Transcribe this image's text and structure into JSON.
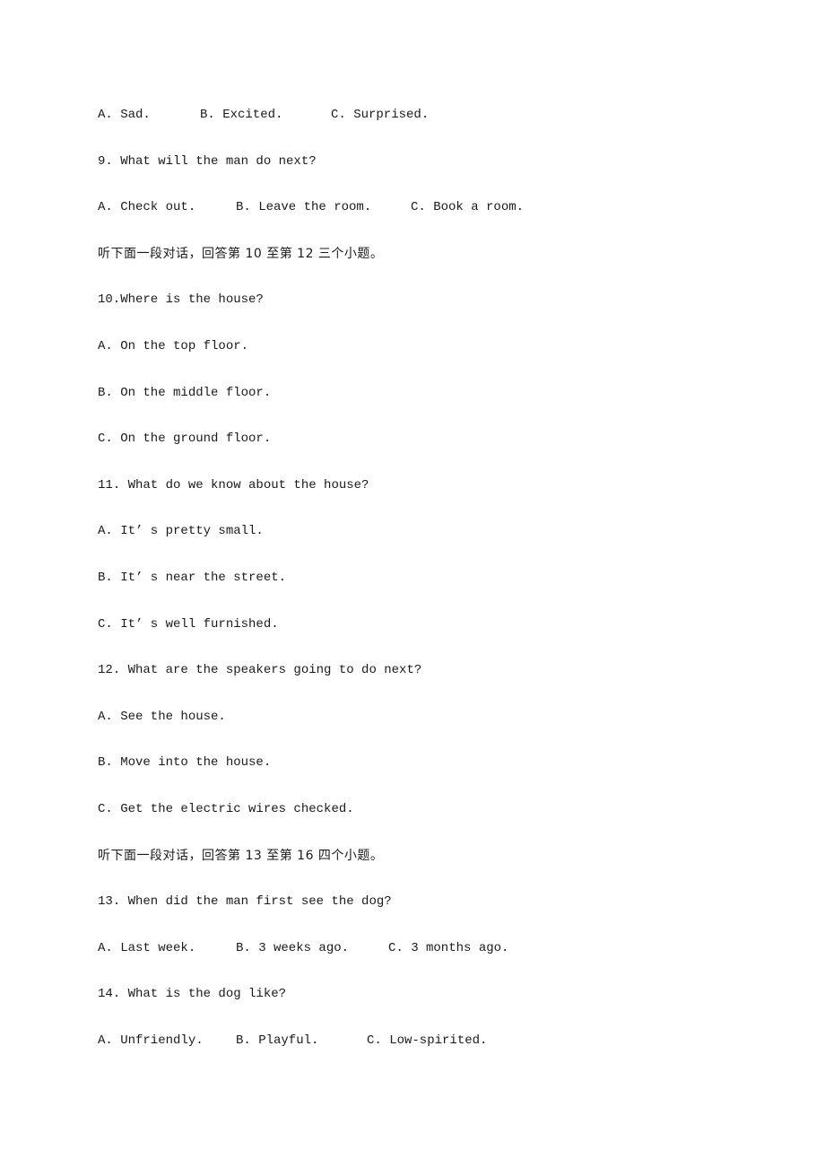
{
  "document": {
    "lines": [
      {
        "type": "options",
        "options": [
          "A. Sad.",
          "B. Excited.",
          "C. Surprised."
        ]
      },
      {
        "type": "question",
        "text": "9. What will the man do next?"
      },
      {
        "type": "options",
        "options": [
          "A. Check out.",
          "B. Leave the room.",
          "C. Book a room."
        ]
      },
      {
        "type": "instruction",
        "text": "听下面一段对话，回答第 10 至第 12 三个小题。"
      },
      {
        "type": "question",
        "text": "10.Where is the house?"
      },
      {
        "type": "option",
        "text": "A. On the top floor."
      },
      {
        "type": "option",
        "text": "B. On the middle floor."
      },
      {
        "type": "option",
        "text": "C. On the ground floor."
      },
      {
        "type": "question",
        "text": "11. What do we know about the house?"
      },
      {
        "type": "option",
        "text": "A. It’ s pretty small."
      },
      {
        "type": "option",
        "text": "B. It’ s near the street."
      },
      {
        "type": "option",
        "text": "C. It’ s well furnished."
      },
      {
        "type": "question",
        "text": "12. What are the speakers going to do next?"
      },
      {
        "type": "option",
        "text": "A. See the house."
      },
      {
        "type": "option",
        "text": "B. Move into the house."
      },
      {
        "type": "option",
        "text": "C. Get the electric wires checked."
      },
      {
        "type": "instruction",
        "text": "听下面一段对话，回答第 13 至第 16 四个小题。"
      },
      {
        "type": "question",
        "text": "13. When did the man first see the dog?"
      },
      {
        "type": "options",
        "options": [
          "A. Last week.",
          "B. 3 weeks ago.",
          "C. 3 months ago."
        ]
      },
      {
        "type": "question",
        "text": "14. What is the dog like?"
      },
      {
        "type": "options",
        "options": [
          "A. Unfriendly.",
          "B. Playful.",
          "C. Low-spirited."
        ]
      }
    ]
  }
}
